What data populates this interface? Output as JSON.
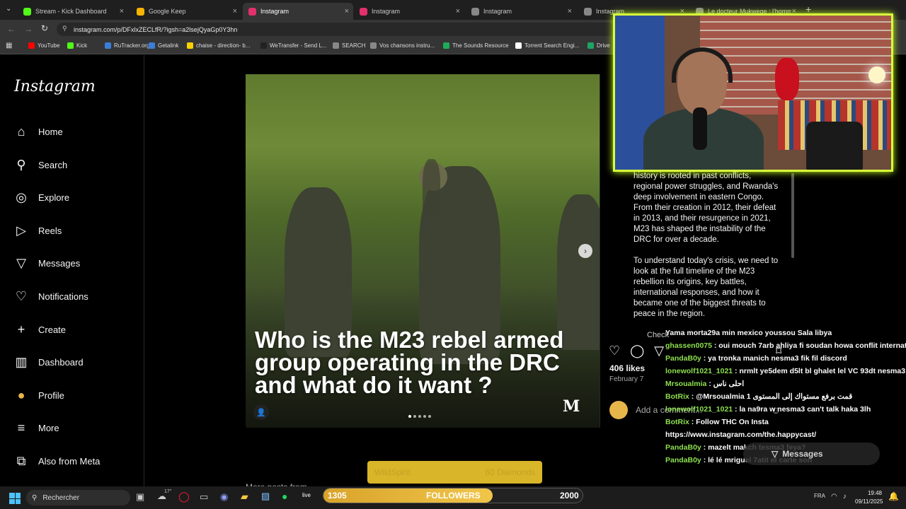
{
  "tabs": [
    {
      "label": "Stream - Kick Dashboard",
      "color": "#53fc18"
    },
    {
      "label": "Google Keep",
      "color": "#f6b400"
    },
    {
      "label": "Instagram",
      "color": "#e1306c",
      "active": true
    },
    {
      "label": "Instagram",
      "color": "#e1306c"
    },
    {
      "label": "Instagram",
      "color": "#888888"
    },
    {
      "label": "Instagram",
      "color": "#888888"
    },
    {
      "label": "Le docteur Mukwege : l'homme",
      "color": "#888888"
    }
  ],
  "url": "instagram.com/p/DFxlxZECLfR/?igsh=a2lsejQyaGp0Y3hn",
  "bookmarks": [
    {
      "label": "YouTube",
      "color": "#ff0000"
    },
    {
      "label": "Kick",
      "color": "#53fc18"
    },
    {
      "label": "RuTracker.org",
      "color": "#3b7dd8"
    },
    {
      "label": "Getalink",
      "color": "#3b7dd8"
    },
    {
      "label": "chaise - direction- b...",
      "color": "#ffd000"
    },
    {
      "label": "WeTransfer - Send L...",
      "color": "#222222"
    },
    {
      "label": "SEARCH",
      "color": "#888888"
    },
    {
      "label": "Vos chansons instru...",
      "color": "#888888"
    },
    {
      "label": "The Sounds Resource",
      "color": "#1faa59"
    },
    {
      "label": "Torrent Search Engi...",
      "color": "#ffffff"
    },
    {
      "label": "Drive",
      "color": "#1fa463"
    }
  ],
  "logo": "Instagram",
  "nav": [
    {
      "label": "Home",
      "icon": "home-icon"
    },
    {
      "label": "Search",
      "icon": "search-icon"
    },
    {
      "label": "Explore",
      "icon": "explore-icon"
    },
    {
      "label": "Reels",
      "icon": "reels-icon"
    },
    {
      "label": "Messages",
      "icon": "messages-icon"
    },
    {
      "label": "Notifications",
      "icon": "heart-icon"
    },
    {
      "label": "Create",
      "icon": "plus-icon"
    },
    {
      "label": "Dashboard",
      "icon": "dashboard-icon"
    },
    {
      "label": "Profile",
      "icon": "avatar"
    },
    {
      "label": "More",
      "icon": "menu-icon"
    },
    {
      "label": "Also from Meta",
      "icon": "meta-icon"
    }
  ],
  "post": {
    "headline": "Who is the M23 rebel armed group operating in the DRC and what do it want ?",
    "caption_p1": "history is rooted in past conflicts, regional power struggles, and Rwanda's deep involvement in eastern Congo. From their creation in 2012, their defeat in 2013, and their resurgence in 2021, M23 has shaped the instability of the DRC for over a decade.",
    "caption_p2": "To understand today's crisis, we need to look at the full timeline of the M23 rebellion its origins, key battles, international responses, and how it became one of the biggest threats to peace in the region.",
    "caption_cut": "Check",
    "likes": "406 likes",
    "date": "February 7",
    "comment_placeholder": "Add a comment...",
    "more_posts": "More posts from"
  },
  "chat": [
    {
      "user": "",
      "text": "Yama morta29a min mexico youssou Sala libya"
    },
    {
      "user": "ghassen0075",
      "text": " : oui mouch 7arb ahliya fi soudan howa conflit internationnal fi soudan"
    },
    {
      "user": "PandaB0y",
      "text": " : ya tronka manich nesma3 fik fil discord"
    },
    {
      "user": "lonewolf1021_1021",
      "text": " : nrmlt ye5dem d5lt bl ghalet lel VC 93dt nesma3 fik"
    },
    {
      "user": "Mrsoualmia",
      "text": " : احلى ناس"
    },
    {
      "user": "BotRix",
      "text": " : @Mrsoualmia قمت برفع مستواك إلى المستوى 1"
    },
    {
      "user": "lonewolf1021_1021",
      "text": " : la na9ra w nesma3 can't talk haka 3lh"
    },
    {
      "user": "BotRix",
      "text": " : Follow THC On Insta"
    },
    {
      "user": "",
      "text": "https://www.instagram.com/the.happycast/"
    },
    {
      "user": "PandaB0y",
      "text": " : mazelt makch tesma3 feya?"
    },
    {
      "user": "PandaB0y",
      "text": " : lé lé mriguel 7atit el carte son"
    }
  ],
  "wildspirit": {
    "name": "WildSpirit",
    "diamonds": "60 Diamonds"
  },
  "followers": {
    "current": "1305",
    "label": "FOLLOWERS",
    "goal": "2000",
    "progress": 0.6525
  },
  "messages_label": "Messages",
  "taskbar": {
    "search": "Rechercher",
    "time": "19:48",
    "date": "09/11/2025",
    "lang": "FRA",
    "temp": "17°"
  }
}
